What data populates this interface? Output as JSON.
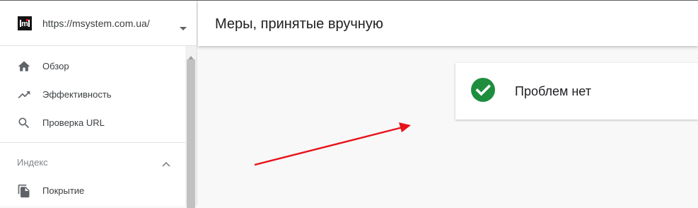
{
  "property": {
    "url": "https://msystem.com.ua/",
    "logo_text": "m"
  },
  "sidebar": {
    "items": [
      {
        "label": "Обзор",
        "icon": "home-icon"
      },
      {
        "label": "Эффективность",
        "icon": "trending-up-icon"
      },
      {
        "label": "Проверка URL",
        "icon": "search-icon"
      }
    ],
    "section": {
      "label": "Индекс",
      "items": [
        {
          "label": "Покрытие",
          "icon": "copy-pages-icon"
        }
      ]
    }
  },
  "header": {
    "title": "Меры, принятые вручную"
  },
  "status_card": {
    "text": "Проблем нет",
    "icon": "check-circle-icon",
    "color": "#1e8e3e"
  },
  "annotation": {
    "icon": "red-arrow",
    "color": "#e8121a"
  }
}
